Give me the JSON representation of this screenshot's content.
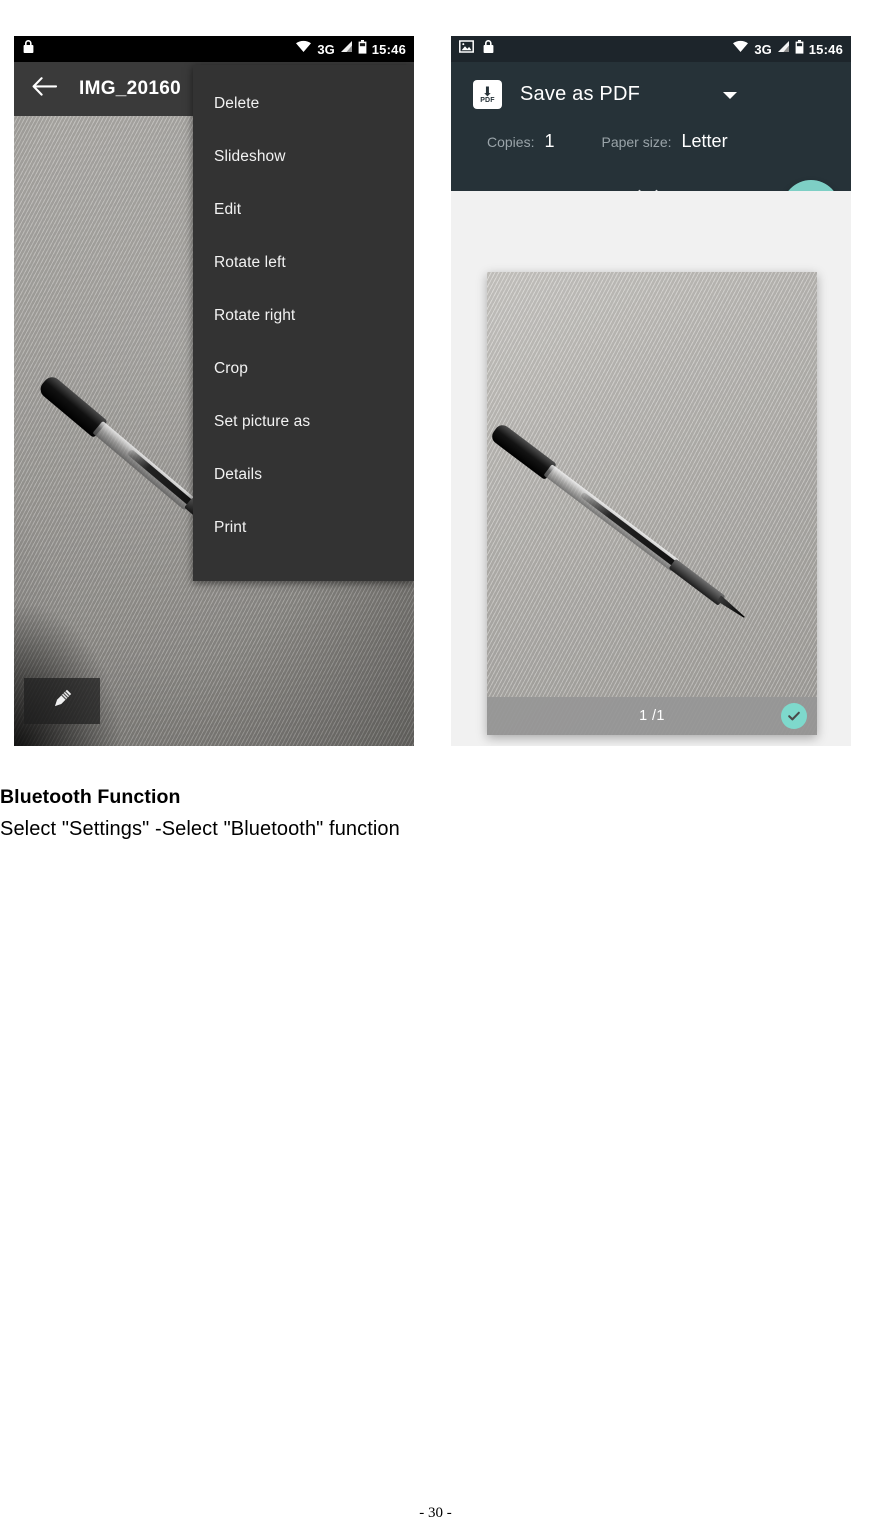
{
  "document": {
    "heading": "Bluetooth Function",
    "body": "Select \"Settings\" -Select \"Bluetooth\" function",
    "page_footer": "- 30 -"
  },
  "left_phone": {
    "status_bar": {
      "lock_icon": "lock-icon",
      "wifi_icon": "wifi-icon",
      "network": "3G",
      "signal_icon": "signal-bars-icon",
      "battery_icon": "battery-icon",
      "time": "15:46"
    },
    "app_bar": {
      "back_icon": "back-arrow-icon",
      "title": "IMG_20160"
    },
    "photo": {
      "subject": "ballpoint-pen-on-wood-surface",
      "edit_overlay_icon": "pencil-icon"
    },
    "overflow_menu": {
      "items": [
        {
          "label": "Delete"
        },
        {
          "label": "Slideshow"
        },
        {
          "label": "Edit"
        },
        {
          "label": "Rotate left"
        },
        {
          "label": "Rotate right"
        },
        {
          "label": "Crop"
        },
        {
          "label": "Set picture as"
        },
        {
          "label": "Details"
        },
        {
          "label": "Print"
        }
      ]
    }
  },
  "right_phone": {
    "status_bar": {
      "image_icon": "image-icon",
      "lock_icon": "lock-icon",
      "wifi_icon": "wifi-icon",
      "network": "3G",
      "signal_icon": "signal-bars-icon",
      "battery_icon": "battery-icon",
      "time": "15:46"
    },
    "print_toolbar": {
      "destination_icon": "pdf-download-icon",
      "destination": "Save as PDF",
      "dropdown_icon": "caret-down-icon",
      "copies_label": "Copies:",
      "copies_value": "1",
      "paper_size_label": "Paper size:",
      "paper_size_value": "Letter",
      "expand_icon": "chevron-down-icon",
      "fab_icon": "pdf-download-icon"
    },
    "preview": {
      "subject": "ballpoint-pen-on-wood-surface",
      "page_count": "1 /1",
      "selected_icon": "check-circle-icon"
    }
  },
  "colors": {
    "status_bar_left": "#000000",
    "app_bar_left": "#3a3a3a",
    "menu_bg": "#333333",
    "print_toolbar": "#263238",
    "accent_teal": "#7ecfc5",
    "preview_bg": "#f1f1f1",
    "page_bar": "#969696"
  }
}
